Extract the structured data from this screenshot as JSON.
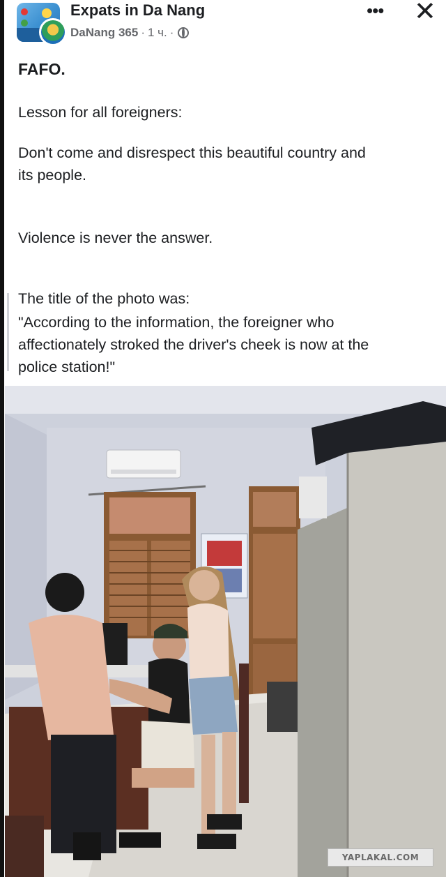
{
  "post": {
    "group_name": "Expats in Da Nang",
    "author": "DaNang 365",
    "separator": "·",
    "time": "1 ч.",
    "more_icon": "more-dots-icon",
    "close_icon": "close-icon",
    "visibility_icon": "globe-icon",
    "paragraphs": [
      "FAFO.",
      "Lesson for all foreigners:",
      "Don't come and disrespect this beautiful country and",
      "its people.",
      "Violence is never the answer.",
      "The title of the photo was:",
      "\"According to the information, the foreigner who",
      "affectionately stroked the driver's cheek is now at the",
      "police station!\""
    ]
  },
  "watermark": "YAPLAKAL.COM",
  "colors": {
    "text": "#1c1e21",
    "meta": "#65676b"
  }
}
